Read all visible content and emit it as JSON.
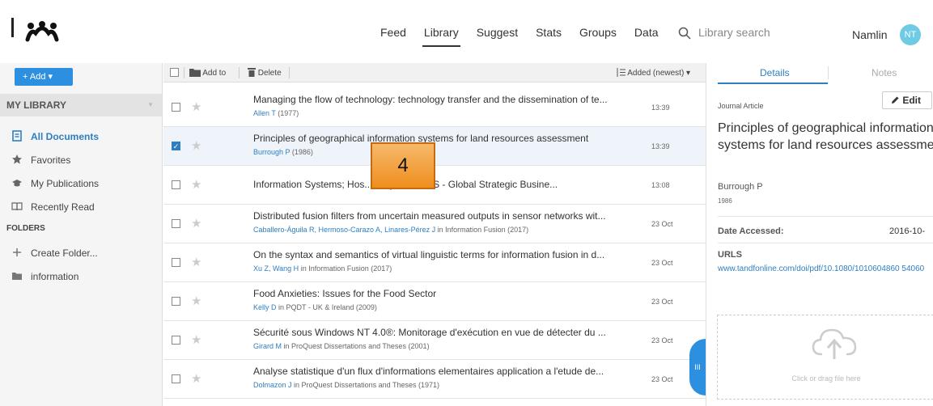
{
  "nav": {
    "feed": "Feed",
    "library": "Library",
    "suggest": "Suggest",
    "stats": "Stats",
    "groups": "Groups",
    "data": "Data"
  },
  "search": {
    "placeholder": "Library search"
  },
  "user": {
    "name": "Namlin",
    "initials": "NT"
  },
  "sidebar": {
    "add_label": "+ Add ▾",
    "my_library": "MY LIBRARY",
    "items": [
      {
        "label": "All Documents",
        "icon": "documents-icon",
        "active": true
      },
      {
        "label": "Favorites",
        "icon": "star-icon"
      },
      {
        "label": "My Publications",
        "icon": "mortarboard-icon"
      },
      {
        "label": "Recently Read",
        "icon": "book-icon"
      }
    ],
    "folders_header": "FOLDERS",
    "create_folder": "Create Folder...",
    "folder_information": "information"
  },
  "toolbar": {
    "add_to": "Add to",
    "delete": "Delete",
    "sort": "Added (newest) ▾"
  },
  "documents": [
    {
      "title": "Managing the flow of technology: technology transfer and the dissemination of te...",
      "authors": "Allen T",
      "source": "(1977)",
      "date": "13:39",
      "checked": false
    },
    {
      "title": "Principles of geographical information systems for land resources assessment",
      "authors": "Burrough P",
      "source": "(1986)",
      "date": "13:39",
      "checked": true
    },
    {
      "title": "Information Systems; Hos... n Systems HIS - Global Strategic Busine...",
      "authors": "",
      "source": "",
      "date": "13:08",
      "checked": false
    },
    {
      "title": "Distributed fusion filters from uncertain measured outputs in sensor networks wit...",
      "authors": "Caballero-Águila R, Hermoso-Carazo A, Linares-Pérez J",
      "source": "in Information Fusion (2017)",
      "date": "23 Oct",
      "checked": false
    },
    {
      "title": "On the syntax and semantics of virtual linguistic terms for information fusion in d...",
      "authors": "Xu Z, Wang H",
      "source": "in Information Fusion (2017)",
      "date": "23 Oct",
      "checked": false
    },
    {
      "title": "Food Anxieties: Issues for the Food Sector",
      "authors": "Kelly D",
      "source": "in PQDT - UK & Ireland (2009)",
      "date": "23 Oct",
      "checked": false
    },
    {
      "title": "Sécurité sous Windows NT 4.0®: Monitorage d'exécution en vue de détecter du ...",
      "authors": "Girard M",
      "source": "in ProQuest Dissertations and Theses (2001)",
      "date": "23 Oct",
      "checked": false
    },
    {
      "title": "Analyse statistique d'un flux d'informations elementaires application a l'etude de...",
      "authors": "Dolmazon J",
      "source": "in ProQuest Dissertations and Theses (1971)",
      "date": "23 Oct",
      "checked": false
    }
  ],
  "overlay_label": "4",
  "panel": {
    "tab_details": "Details",
    "tab_notes": "Notes",
    "edit": "Edit",
    "doc_type": "Journal Article",
    "title": "Principles of geographical information systems for land resources assessment",
    "author": "Burrough P",
    "year": "1986",
    "date_accessed_label": "Date Accessed:",
    "date_accessed_value": "2016-10-",
    "urls_label": "URLS",
    "url": "www.tandfonline.com/doi/pdf/10.1080/1010604860 54060",
    "dropzone_text": "Click or drag file here",
    "collapse_label": "III"
  },
  "colors": {
    "accent": "#2d7fc2",
    "add_button": "#2d8fdf",
    "avatar": "#6ecbe3",
    "overlay": "#f0962a"
  }
}
